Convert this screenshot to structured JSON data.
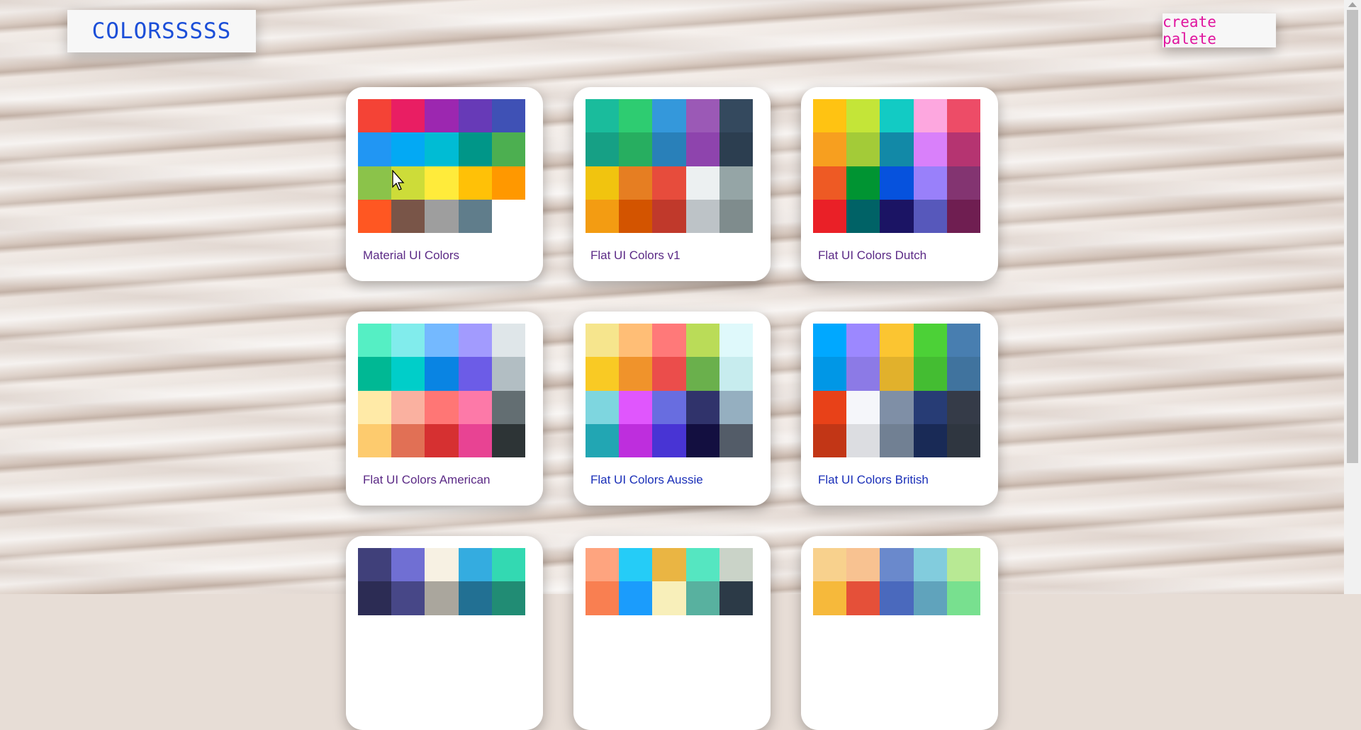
{
  "header": {
    "logo_text": "COLORSSSSS",
    "create_label": "create palete"
  },
  "palettes": [
    {
      "name": "Material UI Colors",
      "colors": [
        "#f44336",
        "#e91e63",
        "#9c27b0",
        "#673ab7",
        "#3f51b5",
        "#2196f3",
        "#03a9f4",
        "#00bcd4",
        "#009688",
        "#4caf50",
        "#8bc34a",
        "#cddc39",
        "#ffeb3b",
        "#ffc107",
        "#ff9800",
        "#ff5722",
        "#795548",
        "#9e9e9e",
        "#607d8b"
      ]
    },
    {
      "name": "Flat UI Colors v1",
      "colors": [
        "#1abc9c",
        "#2ecc71",
        "#3498db",
        "#9b59b6",
        "#34495e",
        "#16a085",
        "#27ae60",
        "#2980b9",
        "#8e44ad",
        "#2c3e50",
        "#f1c40f",
        "#e67e22",
        "#e74c3c",
        "#ecf0f1",
        "#95a5a6",
        "#f39c12",
        "#d35400",
        "#c0392b",
        "#bdc3c7",
        "#7f8c8d"
      ]
    },
    {
      "name": "Flat UI Colors Dutch",
      "colors": [
        "#ffc312",
        "#c4e538",
        "#12cbc4",
        "#fda7df",
        "#ed4c67",
        "#f79f1f",
        "#a3cb38",
        "#1289a7",
        "#d980fa",
        "#b53471",
        "#ee5a24",
        "#009432",
        "#0652dd",
        "#9980fa",
        "#833471",
        "#ea2027",
        "#006266",
        "#1b1464",
        "#5758bb",
        "#6f1e51"
      ]
    },
    {
      "name": "Flat UI Colors American",
      "colors": [
        "#55efc4",
        "#81ecec",
        "#74b9ff",
        "#a29bfe",
        "#dfe6e9",
        "#00b894",
        "#00cec9",
        "#0984e3",
        "#6c5ce7",
        "#b2bec3",
        "#ffeaa7",
        "#fab1a0",
        "#ff7675",
        "#fd79a8",
        "#636e72",
        "#fdcb6e",
        "#e17055",
        "#d63031",
        "#e84393",
        "#2d3436"
      ]
    },
    {
      "name": "Flat UI Colors Aussie",
      "colors": [
        "#f6e58d",
        "#ffbe76",
        "#ff7979",
        "#badc58",
        "#dff9fb",
        "#f9ca24",
        "#f0932b",
        "#eb4d4b",
        "#6ab04c",
        "#c7ecee",
        "#7ed6df",
        "#e056fd",
        "#686de0",
        "#30336b",
        "#95afc0",
        "#22a6b3",
        "#be2edd",
        "#4834d4",
        "#130f40",
        "#535c68"
      ]
    },
    {
      "name": "Flat UI Colors British",
      "colors": [
        "#00a8ff",
        "#9c88ff",
        "#fbc531",
        "#4cd137",
        "#487eb0",
        "#0097e6",
        "#8c7ae6",
        "#e1b12c",
        "#44bd32",
        "#40739e",
        "#e84118",
        "#f5f6fa",
        "#7f8fa6",
        "#273c75",
        "#353b48",
        "#c23616",
        "#dcdde1",
        "#718093",
        "#192a56",
        "#2f3640"
      ]
    },
    {
      "name": "",
      "colors": [
        "#40407a",
        "#706fd3",
        "#f7f1e3",
        "#34ace0",
        "#33d9b2",
        "#2c2c54",
        "#474787",
        "#aaa69d",
        "#227093",
        "#218c74"
      ]
    },
    {
      "name": "",
      "colors": [
        "#fea47f",
        "#25ccf7",
        "#eab543",
        "#55e6c1",
        "#cad3c8",
        "#f97f51",
        "#1b9cfc",
        "#f8efba",
        "#58b19f",
        "#2c3a47"
      ]
    },
    {
      "name": "",
      "colors": [
        "#f8d18d",
        "#f8c291",
        "#6a89cc",
        "#82ccdd",
        "#b8e994",
        "#f6b93b",
        "#e55039",
        "#4a69bd",
        "#60a3bc",
        "#78e08f"
      ]
    }
  ]
}
